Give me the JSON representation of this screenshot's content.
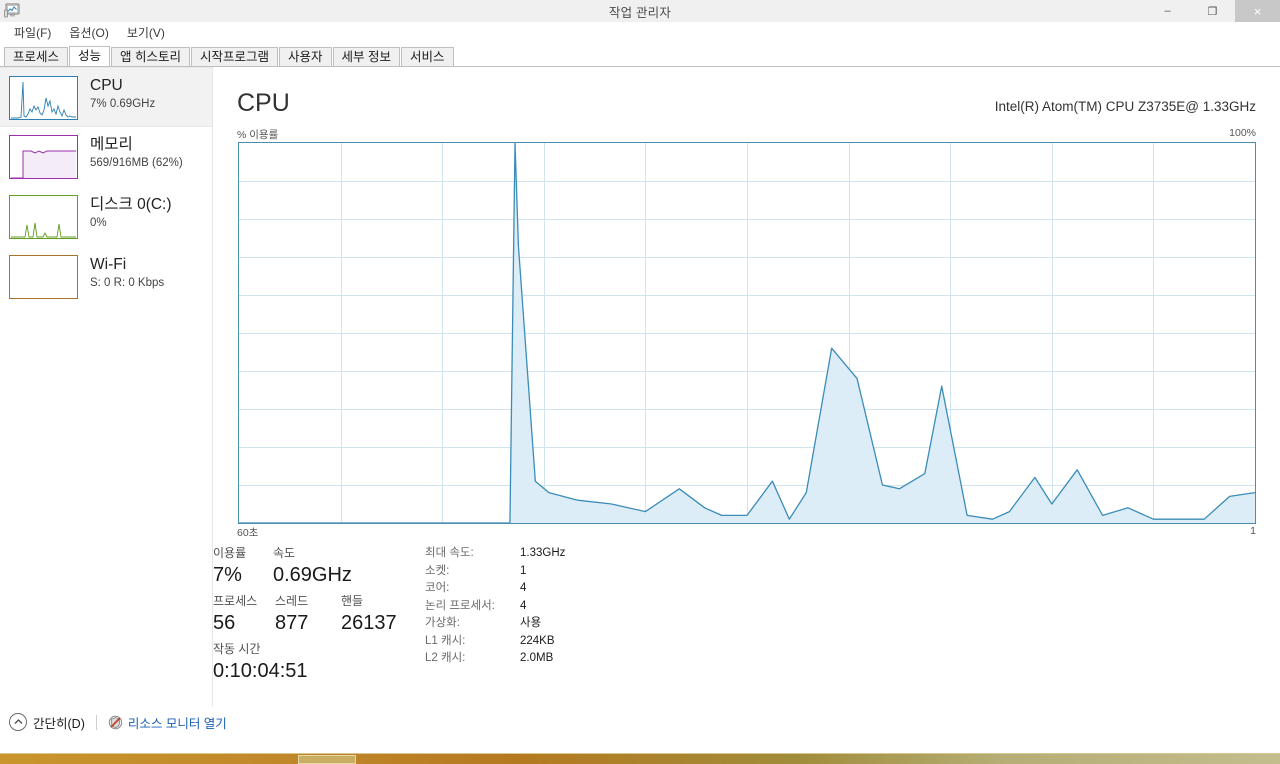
{
  "window": {
    "title": "작업 관리자",
    "icon": "task-manager-icon",
    "minimize": "–",
    "maximize": "❐",
    "close": "×"
  },
  "menu": {
    "items": [
      {
        "label": "파일(F)"
      },
      {
        "label": "옵션(O)"
      },
      {
        "label": "보기(V)"
      }
    ]
  },
  "tabs": [
    {
      "label": "프로세스",
      "active": false
    },
    {
      "label": "성능",
      "active": true
    },
    {
      "label": "앱 히스토리",
      "active": false
    },
    {
      "label": "시작프로그램",
      "active": false
    },
    {
      "label": "사용자",
      "active": false
    },
    {
      "label": "세부 정보",
      "active": false
    },
    {
      "label": "서비스",
      "active": false
    }
  ],
  "sidebar": {
    "items": [
      {
        "name": "CPU",
        "title": "CPU",
        "subtitle": "7% 0.69GHz",
        "color": "#2a7fb5",
        "selected": true
      },
      {
        "name": "memory",
        "title": "메모리",
        "subtitle": "569/916MB (62%)",
        "color": "#9b2fae",
        "selected": false
      },
      {
        "name": "disk",
        "title": "디스크 0(C:)",
        "subtitle": "0%",
        "color": "#5f9e1f",
        "selected": false
      },
      {
        "name": "wifi",
        "title": "Wi-Fi",
        "subtitle": "S: 0 R: 0 Kbps",
        "color": "#a8742a",
        "selected": false
      }
    ]
  },
  "main": {
    "heading": "CPU",
    "model": "Intel(R) Atom(TM) CPU Z3735E@ 1.33GHz",
    "axis_top_left": "% 이용률",
    "axis_top_right": "100%",
    "axis_bottom_left": "60초",
    "axis_bottom_right": "1"
  },
  "stats": {
    "utilization_label": "이용률",
    "utilization_value": "7%",
    "speed_label": "속도",
    "speed_value": "0.69GHz",
    "processes_label": "프로세스",
    "processes_value": "56",
    "threads_label": "스레드",
    "threads_value": "877",
    "handles_label": "핸들",
    "handles_value": "26137",
    "uptime_label": "작동 시간",
    "uptime_value": "0:10:04:51"
  },
  "specs": [
    {
      "label": "최대 속도:",
      "value": "1.33GHz"
    },
    {
      "label": "소켓:",
      "value": "1"
    },
    {
      "label": "코어:",
      "value": "4"
    },
    {
      "label": "논리 프로세서:",
      "value": "4"
    },
    {
      "label": "가상화:",
      "value": "사용"
    },
    {
      "label": "L1 캐시:",
      "value": "224KB"
    },
    {
      "label": "L2 캐시:",
      "value": "2.0MB"
    }
  ],
  "footer": {
    "fewer_details": "간단히(D)",
    "resource_monitor": "리소스 모니터 열기"
  },
  "chart_data": {
    "type": "area",
    "title": "CPU 이용률",
    "xlabel": "60초",
    "ylabel": "% 이용률",
    "ylim": [
      0,
      100
    ],
    "xlim": [
      0,
      60
    ],
    "grid": true,
    "line_color": "#3b8cb8",
    "fill_color": "#dcedf7",
    "grid_color": "#cfe4ef",
    "x_gridlines": 10,
    "y_gridlines": 10,
    "series": [
      {
        "name": "CPU 이용률",
        "x": [
          0,
          16.0,
          16.3,
          16.5,
          17.5,
          18.3,
          20.0,
          22.0,
          24.0,
          26.0,
          27.5,
          28.5,
          30.0,
          31.5,
          32.5,
          33.5,
          35.0,
          36.5,
          38.0,
          39.0,
          40.5,
          41.5,
          43.0,
          44.5,
          45.5,
          47.0,
          48.0,
          49.5,
          51.0,
          52.5,
          54.0,
          55.5,
          57.0,
          58.5,
          60.0
        ],
        "values": [
          0,
          0,
          100,
          73,
          11,
          8,
          6,
          5,
          3,
          9,
          4,
          2,
          2,
          11,
          1,
          8,
          46,
          38,
          10,
          9,
          13,
          36,
          2,
          1,
          3,
          12,
          5,
          14,
          2,
          4,
          1,
          1,
          1,
          7,
          8
        ]
      }
    ]
  }
}
